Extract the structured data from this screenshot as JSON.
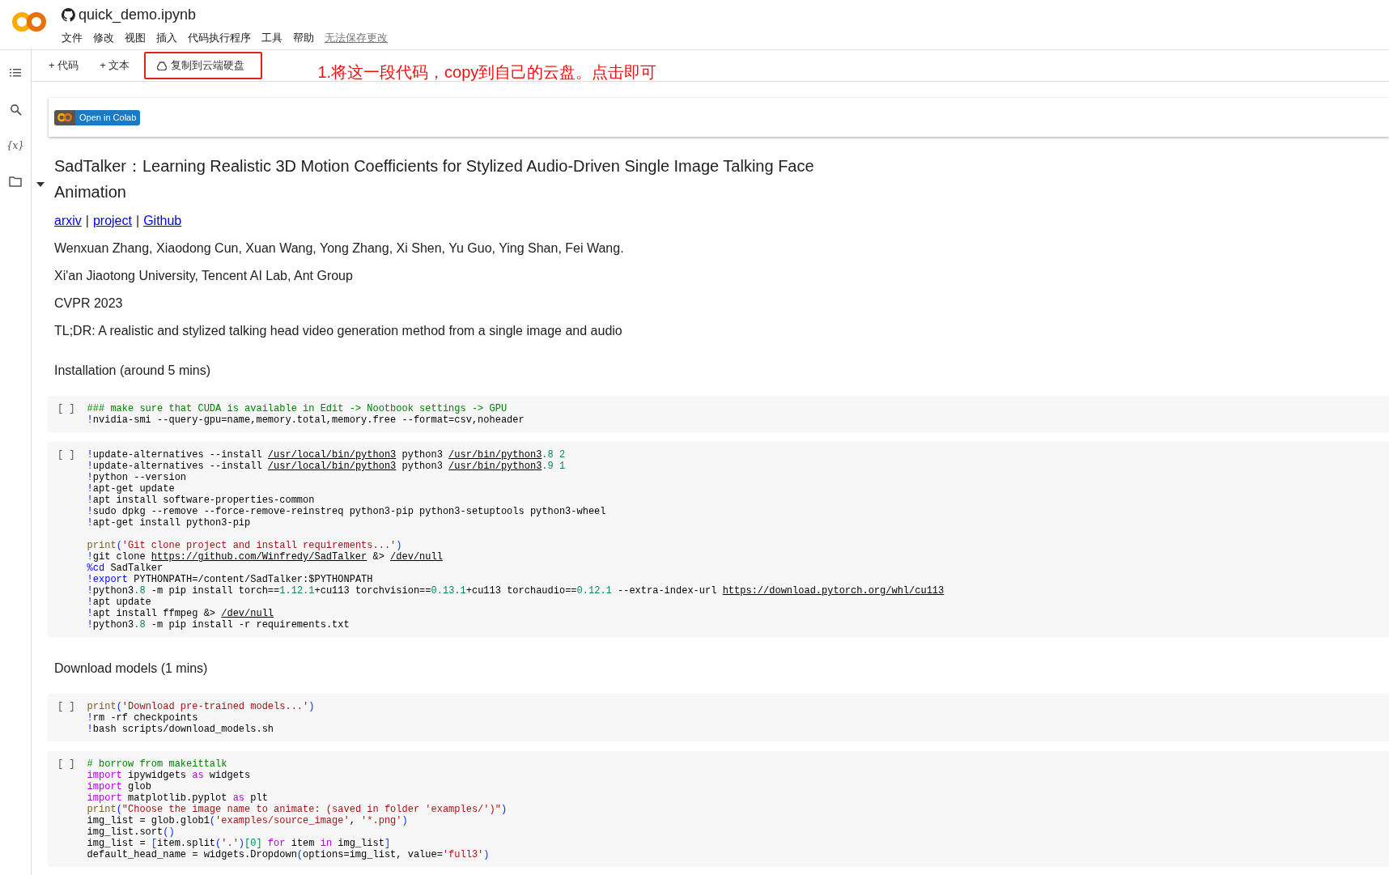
{
  "header": {
    "file_name": "quick_demo.ipynb",
    "menu": [
      "文件",
      "修改",
      "视图",
      "插入",
      "代码执行程序",
      "工具",
      "帮助"
    ],
    "save_notice": "无法保存更改"
  },
  "toolbar": {
    "buttons": [
      {
        "label": "+ 代码",
        "kind": "add"
      },
      {
        "label": "+ 文本",
        "kind": "add"
      },
      {
        "label": "复制到云端硬盘",
        "kind": "drive",
        "annotated": true
      }
    ],
    "annotation": "1.将这一段代码，copy到自己的云盘。点击即可"
  },
  "sidebar": {
    "items": [
      {
        "kind": "toc"
      },
      {
        "kind": "search"
      },
      {
        "kind": "variables",
        "label": "{x}"
      },
      {
        "kind": "files"
      }
    ]
  },
  "badge": {
    "label": "Open in Colab"
  },
  "markdown": {
    "expanded": true,
    "title": "SadTalker：Learning Realistic 3D Motion Coefficients for Stylized Audio-Driven Single Image Talking Face Animation",
    "links": [
      "arxiv",
      "project",
      "Github"
    ],
    "separator": "|",
    "paragraphs": [
      "Wenxuan Zhang, Xiaodong Cun, Xuan Wang, Yong Zhang, Xi Shen, Yu Guo, Ying Shan, Fei Wang.",
      "Xi'an Jiaotong University, Tencent AI Lab, Ant Group",
      "CVPR 2023",
      "TL;DR: A realistic and stylized talking head video generation method from a single image and audio"
    ]
  },
  "sections": [
    {
      "heading": "Installation (around 5 mins)",
      "cells": [
        {
          "run_label": "[ ]",
          "lines": [
            {
              "kind": "code",
              "spans": [
                {
                  "text": "### make sure that CUDA is available in Edit -> Nootbook settings -> GPU",
                  "kind": "comment"
                }
              ]
            },
            {
              "kind": "code",
              "spans": [
                {
                  "text": "!",
                  "kind": "magic"
                },
                {
                  "text": "nvidia-smi --query-gpu=name,memory.total,memory.free --format=csv,noheader",
                  "kind": "plain"
                }
              ]
            }
          ]
        },
        {
          "run_label": "[ ]",
          "lines": [
            {
              "kind": "code",
              "spans": [
                {
                  "text": "!",
                  "kind": "magic"
                },
                {
                  "text": "update-alternatives --install ",
                  "kind": "plain"
                },
                {
                  "text": "/usr/local/bin/python3",
                  "kind": "link"
                },
                {
                  "text": " python3 ",
                  "kind": "plain"
                },
                {
                  "text": "/usr/bin/python3",
                  "kind": "link"
                },
                {
                  "text": ".8",
                  "kind": "number"
                },
                {
                  "text": " 2",
                  "kind": "number"
                }
              ]
            },
            {
              "kind": "code",
              "spans": [
                {
                  "text": "!",
                  "kind": "magic"
                },
                {
                  "text": "update-alternatives --install ",
                  "kind": "plain"
                },
                {
                  "text": "/usr/local/bin/python3",
                  "kind": "link"
                },
                {
                  "text": " python3 ",
                  "kind": "plain"
                },
                {
                  "text": "/usr/bin/python3",
                  "kind": "link"
                },
                {
                  "text": ".9",
                  "kind": "number"
                },
                {
                  "text": " 1",
                  "kind": "number"
                }
              ]
            },
            {
              "kind": "code",
              "spans": [
                {
                  "text": "!",
                  "kind": "magic"
                },
                {
                  "text": "python --version",
                  "kind": "plain"
                }
              ]
            },
            {
              "kind": "code",
              "spans": [
                {
                  "text": "!",
                  "kind": "magic"
                },
                {
                  "text": "apt-get update",
                  "kind": "plain"
                }
              ]
            },
            {
              "kind": "code",
              "spans": [
                {
                  "text": "!",
                  "kind": "magic"
                },
                {
                  "text": "apt install software-properties-common",
                  "kind": "plain"
                }
              ]
            },
            {
              "kind": "code",
              "spans": [
                {
                  "text": "!",
                  "kind": "magic"
                },
                {
                  "text": "sudo dpkg --remove --force-remove-reinstreq python3-pip python3-setuptools python3-wheel",
                  "kind": "plain"
                }
              ]
            },
            {
              "kind": "code",
              "spans": [
                {
                  "text": "!",
                  "kind": "magic"
                },
                {
                  "text": "apt-get install python3-pip",
                  "kind": "plain"
                }
              ]
            },
            {
              "kind": "blank"
            },
            {
              "kind": "code",
              "spans": [
                {
                  "text": "print",
                  "kind": "function"
                },
                {
                  "text": "(",
                  "kind": "bracket"
                },
                {
                  "text": "'Git clone project and install requirements...'",
                  "kind": "string"
                },
                {
                  "text": ")",
                  "kind": "bracket"
                }
              ]
            },
            {
              "kind": "code",
              "spans": [
                {
                  "text": "!",
                  "kind": "magic"
                },
                {
                  "text": "git clone ",
                  "kind": "plain"
                },
                {
                  "text": "https://github.com/Winfredy/SadTalker",
                  "kind": "link"
                },
                {
                  "text": " &> ",
                  "kind": "plain"
                },
                {
                  "text": "/dev/null",
                  "kind": "link"
                }
              ]
            },
            {
              "kind": "code",
              "spans": [
                {
                  "text": "%cd",
                  "kind": "magic"
                },
                {
                  "text": " SadTalker",
                  "kind": "plain"
                }
              ]
            },
            {
              "kind": "code",
              "spans": [
                {
                  "text": "!",
                  "kind": "magic"
                },
                {
                  "text": "export",
                  "kind": "magic"
                },
                {
                  "text": " PYTHONPATH=/content/SadTalker:$PYTHONPATH",
                  "kind": "plain"
                }
              ]
            },
            {
              "kind": "code",
              "spans": [
                {
                  "text": "!",
                  "kind": "magic"
                },
                {
                  "text": "python3",
                  "kind": "plain"
                },
                {
                  "text": ".8",
                  "kind": "number"
                },
                {
                  "text": " -m pip install torch==",
                  "kind": "plain"
                },
                {
                  "text": "1.12.1",
                  "kind": "number"
                },
                {
                  "text": "+cu113 torchvision==",
                  "kind": "plain"
                },
                {
                  "text": "0.13.1",
                  "kind": "number"
                },
                {
                  "text": "+cu113 torchaudio==",
                  "kind": "plain"
                },
                {
                  "text": "0.12.1",
                  "kind": "number"
                },
                {
                  "text": " --extra-index-url ",
                  "kind": "plain"
                },
                {
                  "text": "https://download.pytorch.org/whl/cu113",
                  "kind": "link"
                }
              ]
            },
            {
              "kind": "code",
              "spans": [
                {
                  "text": "!",
                  "kind": "magic"
                },
                {
                  "text": "apt update",
                  "kind": "plain"
                }
              ]
            },
            {
              "kind": "code",
              "spans": [
                {
                  "text": "!",
                  "kind": "magic"
                },
                {
                  "text": "apt install ffmpeg &> ",
                  "kind": "plain"
                },
                {
                  "text": "/dev/null",
                  "kind": "link"
                }
              ]
            },
            {
              "kind": "code",
              "spans": [
                {
                  "text": "!",
                  "kind": "magic"
                },
                {
                  "text": "python3",
                  "kind": "plain"
                },
                {
                  "text": ".8",
                  "kind": "number"
                },
                {
                  "text": " -m pip install -r requirements.txt",
                  "kind": "plain"
                }
              ]
            }
          ]
        }
      ]
    },
    {
      "heading": "Download models (1 mins)",
      "cells": [
        {
          "run_label": "[ ]",
          "lines": [
            {
              "kind": "code",
              "spans": [
                {
                  "text": "print",
                  "kind": "function"
                },
                {
                  "text": "(",
                  "kind": "bracket"
                },
                {
                  "text": "'Download pre-trained models...'",
                  "kind": "string"
                },
                {
                  "text": ")",
                  "kind": "bracket"
                }
              ]
            },
            {
              "kind": "code",
              "spans": [
                {
                  "text": "!",
                  "kind": "magic"
                },
                {
                  "text": "rm -rf checkpoints",
                  "kind": "plain"
                }
              ]
            },
            {
              "kind": "code",
              "spans": [
                {
                  "text": "!",
                  "kind": "magic"
                },
                {
                  "text": "bash scripts/download_models.sh",
                  "kind": "plain"
                }
              ]
            }
          ]
        },
        {
          "run_label": "[ ]",
          "lines": [
            {
              "kind": "code",
              "spans": [
                {
                  "text": "# borrow from makeittalk",
                  "kind": "comment"
                }
              ]
            },
            {
              "kind": "code",
              "spans": [
                {
                  "text": "import",
                  "kind": "keyword"
                },
                {
                  "text": " ipywidgets ",
                  "kind": "plain"
                },
                {
                  "text": "as",
                  "kind": "keyword"
                },
                {
                  "text": " widgets",
                  "kind": "plain"
                }
              ]
            },
            {
              "kind": "code",
              "spans": [
                {
                  "text": "import",
                  "kind": "keyword"
                },
                {
                  "text": " glob",
                  "kind": "plain"
                }
              ]
            },
            {
              "kind": "code",
              "spans": [
                {
                  "text": "import",
                  "kind": "keyword"
                },
                {
                  "text": " matplotlib.pyplot ",
                  "kind": "plain"
                },
                {
                  "text": "as",
                  "kind": "keyword"
                },
                {
                  "text": " plt",
                  "kind": "plain"
                }
              ]
            },
            {
              "kind": "code",
              "spans": [
                {
                  "text": "print",
                  "kind": "function"
                },
                {
                  "text": "(",
                  "kind": "bracket"
                },
                {
                  "text": "\"Choose the image name to animate: (saved in folder 'examples/')\"",
                  "kind": "string"
                },
                {
                  "text": ")",
                  "kind": "bracket"
                }
              ]
            },
            {
              "kind": "code",
              "spans": [
                {
                  "text": "img_list = glob.glob1",
                  "kind": "plain"
                },
                {
                  "text": "(",
                  "kind": "bracket"
                },
                {
                  "text": "'examples/source_image'",
                  "kind": "string"
                },
                {
                  "text": ", ",
                  "kind": "plain"
                },
                {
                  "text": "'*.png'",
                  "kind": "string"
                },
                {
                  "text": ")",
                  "kind": "bracket"
                }
              ]
            },
            {
              "kind": "code",
              "spans": [
                {
                  "text": "img_list.sort",
                  "kind": "plain"
                },
                {
                  "text": "()",
                  "kind": "bracket"
                }
              ]
            },
            {
              "kind": "code",
              "spans": [
                {
                  "text": "img_list = ",
                  "kind": "plain"
                },
                {
                  "text": "[",
                  "kind": "bracket"
                },
                {
                  "text": "item.split",
                  "kind": "plain"
                },
                {
                  "text": "(",
                  "kind": "bracket"
                },
                {
                  "text": "'.'",
                  "kind": "string"
                },
                {
                  "text": ")",
                  "kind": "bracket"
                },
                {
                  "text": "[0]",
                  "kind": "number"
                },
                {
                  "text": " for ",
                  "kind": "keyword"
                },
                {
                  "text": "item ",
                  "kind": "plain"
                },
                {
                  "text": "in",
                  "kind": "keyword"
                },
                {
                  "text": " img_list",
                  "kind": "plain"
                },
                {
                  "text": "]",
                  "kind": "bracket"
                }
              ]
            },
            {
              "kind": "code",
              "spans": [
                {
                  "text": "default_head_name = widgets.Dropdown",
                  "kind": "plain"
                },
                {
                  "text": "(",
                  "kind": "bracket"
                },
                {
                  "text": "options=img_list, value=",
                  "kind": "plain"
                },
                {
                  "text": "'full3'",
                  "kind": "string"
                },
                {
                  "text": ")",
                  "kind": "bracket"
                }
              ]
            }
          ]
        }
      ]
    }
  ]
}
